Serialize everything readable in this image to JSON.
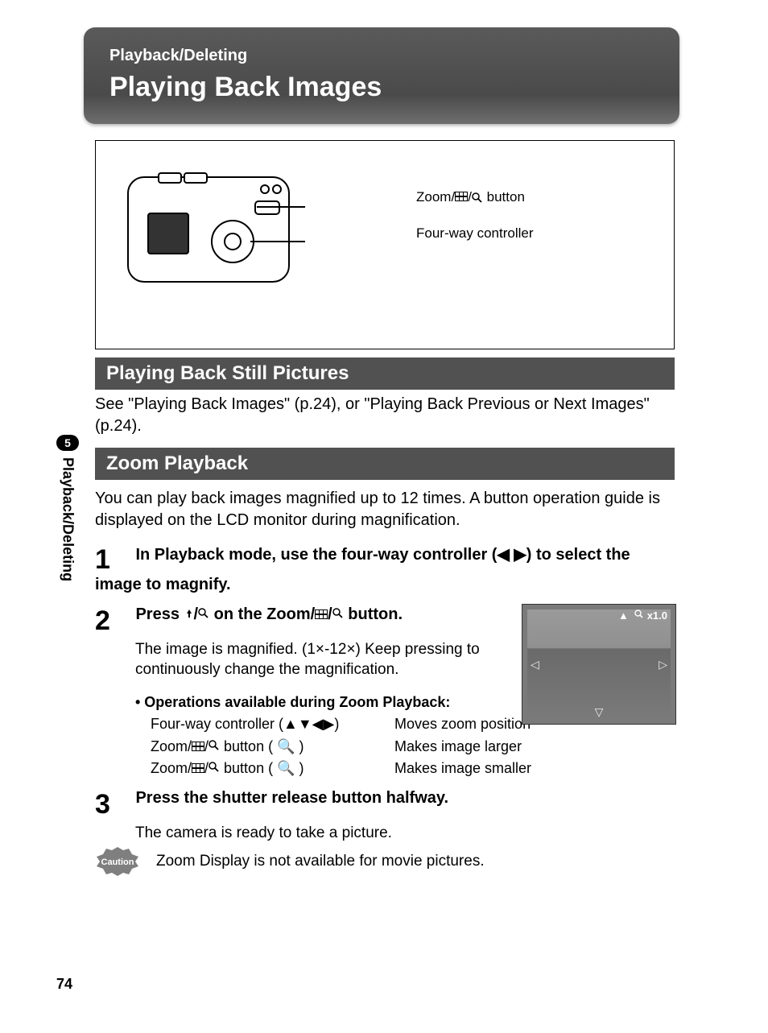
{
  "page_number": "74",
  "sidebar": {
    "chapter_number": "5",
    "label": "Playback/Deleting"
  },
  "banner": {
    "category": "Playback/Deleting",
    "title": "Playing Back Images"
  },
  "camera_callouts": {
    "zoom_button_prefix": "Zoom/",
    "zoom_button_suffix": " button",
    "fourway": "Four-way controller"
  },
  "section1": {
    "title": "Playing Back Still Pictures",
    "body": "See \"Playing Back Images\" (p.24), or \"Playing Back Previous or Next Images\" (p.24)."
  },
  "section2": {
    "title": "Zoom Playback",
    "intro": "You can play back images magnified up to 12 times. A button operation guide is displayed on the LCD monitor during magnification."
  },
  "steps": {
    "s1": {
      "num": "1",
      "head": "In Playback mode, use the four-way controller (◀ ▶) to select the image to magnify."
    },
    "s2": {
      "num": "2",
      "head_prefix": "Press ",
      "head_mid": " on the Zoom/",
      "head_suffix": " button.",
      "body": "The image is magnified. (1×-12×) Keep pressing to continuously change the magnification.",
      "ops_title": "• Operations available during Zoom Playback:",
      "ops": {
        "row1a": "Four-way controller (▲▼◀▶)",
        "row1b": "Moves zoom position",
        "row2a_prefix": "Zoom/",
        "row2a_suffix": " button ( 🔍 )",
        "row2b": "Makes image larger",
        "row3a_prefix": "Zoom/",
        "row3a_suffix": " button ( 🔍 )",
        "row3b": "Makes image smaller"
      }
    },
    "s3": {
      "num": "3",
      "head": "Press the shutter release button halfway.",
      "body": "The camera is ready to take a picture."
    }
  },
  "lcd": {
    "up": "▲",
    "mag_icon": "🔍",
    "zoom": "x1.0",
    "left": "◁",
    "right": "▷",
    "down": "▽"
  },
  "caution": {
    "badge": "Caution",
    "text": "Zoom Display is not available for movie pictures."
  }
}
